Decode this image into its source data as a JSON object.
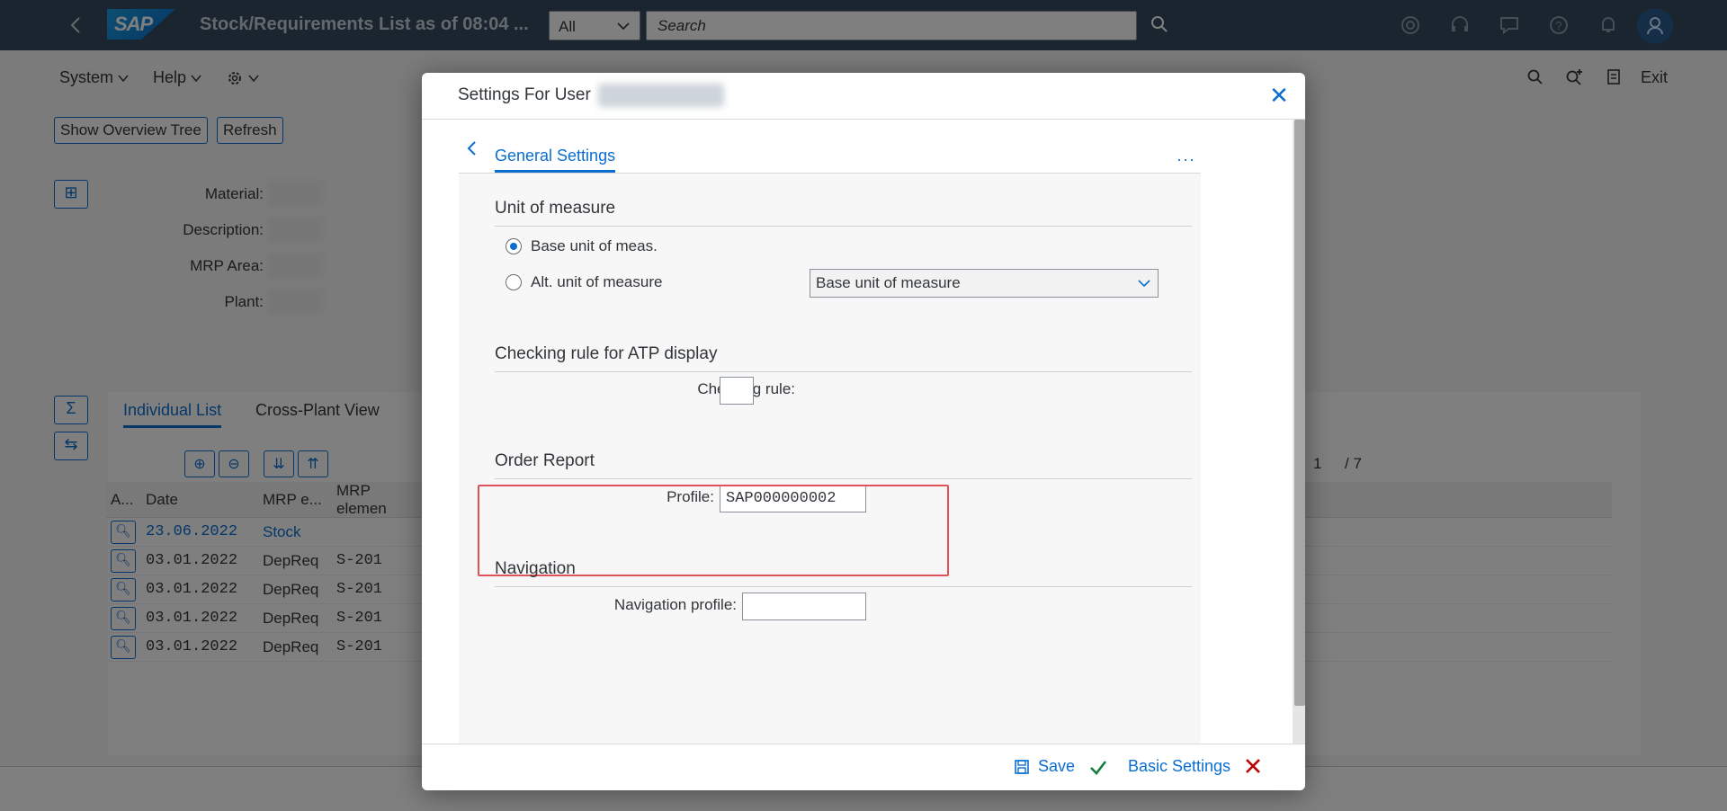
{
  "shell": {
    "app_title": "Stock/Requirements List as of 08:04 ...",
    "scope": "All",
    "search_placeholder": "Search"
  },
  "menu": {
    "system": "System",
    "help": "Help"
  },
  "toolbar_right": {
    "exit": "Exit"
  },
  "buttons": {
    "overview_tree": "Show Overview Tree",
    "refresh": "Refresh"
  },
  "header_fields": [
    {
      "label": "Material:"
    },
    {
      "label": "Description:"
    },
    {
      "label": "MRP Area:"
    },
    {
      "label": "Plant:"
    }
  ],
  "tabs": {
    "individual": "Individual List",
    "cross_plant": "Cross-Plant View"
  },
  "paging": {
    "current": "1",
    "total": "/ 7"
  },
  "grid": {
    "columns": [
      "A...",
      "Date",
      "MRP e...",
      "MRP elemen"
    ],
    "rows": [
      {
        "date": "23.06.2022",
        "mrp": "Stock",
        "elem": ""
      },
      {
        "date": "03.01.2022",
        "mrp": "DepReq",
        "elem": "S-201"
      },
      {
        "date": "03.01.2022",
        "mrp": "DepReq",
        "elem": "S-201"
      },
      {
        "date": "03.01.2022",
        "mrp": "DepReq",
        "elem": "S-201"
      },
      {
        "date": "03.01.2022",
        "mrp": "DepReq",
        "elem": "S-201"
      }
    ]
  },
  "dialog": {
    "title": "Settings For User",
    "nav_tab": "General Settings",
    "uom": {
      "title": "Unit of measure",
      "base_option": "Base unit of meas.",
      "alt_option": "Alt. unit of measure",
      "select_value": "Base unit of measure"
    },
    "atp": {
      "title": "Checking rule for ATP display",
      "label": "Checking rule:",
      "value": ""
    },
    "order_report": {
      "title": "Order Report",
      "label": "Profile:",
      "value": "SAP000000002"
    },
    "navigation": {
      "title": "Navigation",
      "label": "Navigation profile:",
      "value": ""
    },
    "footer": {
      "save": "Save",
      "basic_settings": "Basic Settings"
    }
  },
  "colors": {
    "shell": "#354a5f",
    "accent": "#0a6ed1",
    "highlight": "#e0525a",
    "cancel": "#bb0000",
    "ok": "#107e3e"
  }
}
